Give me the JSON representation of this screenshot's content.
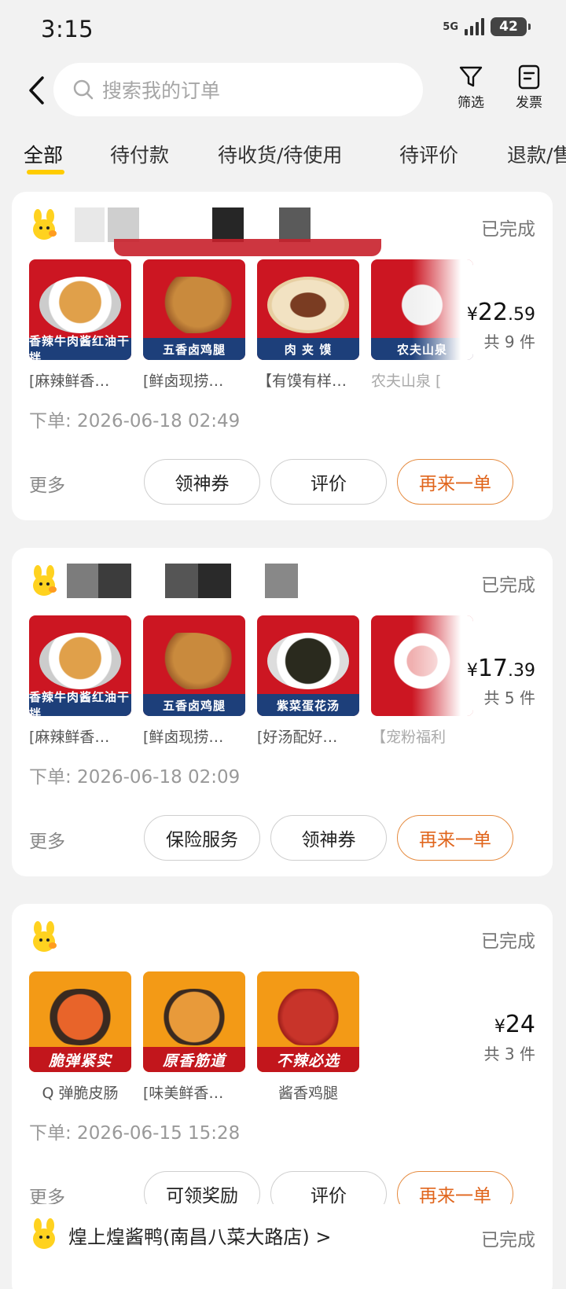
{
  "status_bar": {
    "time": "3:15",
    "network": "5G",
    "battery": "42"
  },
  "search": {
    "placeholder": "搜索我的订单"
  },
  "header": {
    "filter_label": "筛选",
    "invoice_label": "发票"
  },
  "tabs": [
    "全部",
    "待付款",
    "待收货/待使用",
    "待评价",
    "退款/售后"
  ],
  "orders": [
    {
      "status": "已完成",
      "items": [
        {
          "caption": "香辣牛肉酱红油干拌",
          "name": "[麻辣鲜香…"
        },
        {
          "caption": "五香卤鸡腿",
          "name": "[鲜卤现捞…"
        },
        {
          "caption": "肉 夹 馍",
          "name": "【有馍有样…"
        },
        {
          "caption": "农夫山泉",
          "name": "农夫山泉 ["
        }
      ],
      "price_main": "22",
      "price_dec": ".59",
      "count": "共 9 件",
      "order_time": "下单: 2026-06-18 02:49",
      "more": "更多",
      "buttons": [
        "领神券",
        "评价",
        "再来一单"
      ]
    },
    {
      "status": "已完成",
      "items": [
        {
          "caption": "香辣牛肉酱红油干拌",
          "name": "[麻辣鲜香…"
        },
        {
          "caption": "五香卤鸡腿",
          "name": "[鲜卤现捞…"
        },
        {
          "caption": "紫菜蛋花汤",
          "name": "[好汤配好…"
        },
        {
          "caption": "",
          "name": "【宠粉福利"
        }
      ],
      "price_main": "17",
      "price_dec": ".39",
      "count": "共 5 件",
      "order_time": "下单: 2026-06-18 02:09",
      "more": "更多",
      "buttons": [
        "保险服务",
        "领神券",
        "再来一单"
      ]
    },
    {
      "status": "已完成",
      "items": [
        {
          "caption": "脆弹紧实",
          "name": "Q 弹脆皮肠"
        },
        {
          "caption": "原香筋道",
          "name": "[味美鲜香…"
        },
        {
          "caption": "不辣必选",
          "name": "酱香鸡腿"
        }
      ],
      "price_main": "24",
      "price_dec": "",
      "count": "共 3 件",
      "order_time": "下单: 2026-06-15 15:28",
      "more": "更多",
      "buttons": [
        "可领奖励",
        "评价",
        "再来一单"
      ]
    },
    {
      "shop": "煌上煌酱鸭(南昌八菜大路店) >",
      "status": "已完成"
    }
  ],
  "currency": "¥",
  "colors": {
    "accent": "#ffcc00",
    "primary_btn": "#e0651c",
    "dish_red": "#cc1622",
    "dish_orange": "#f39a16"
  }
}
